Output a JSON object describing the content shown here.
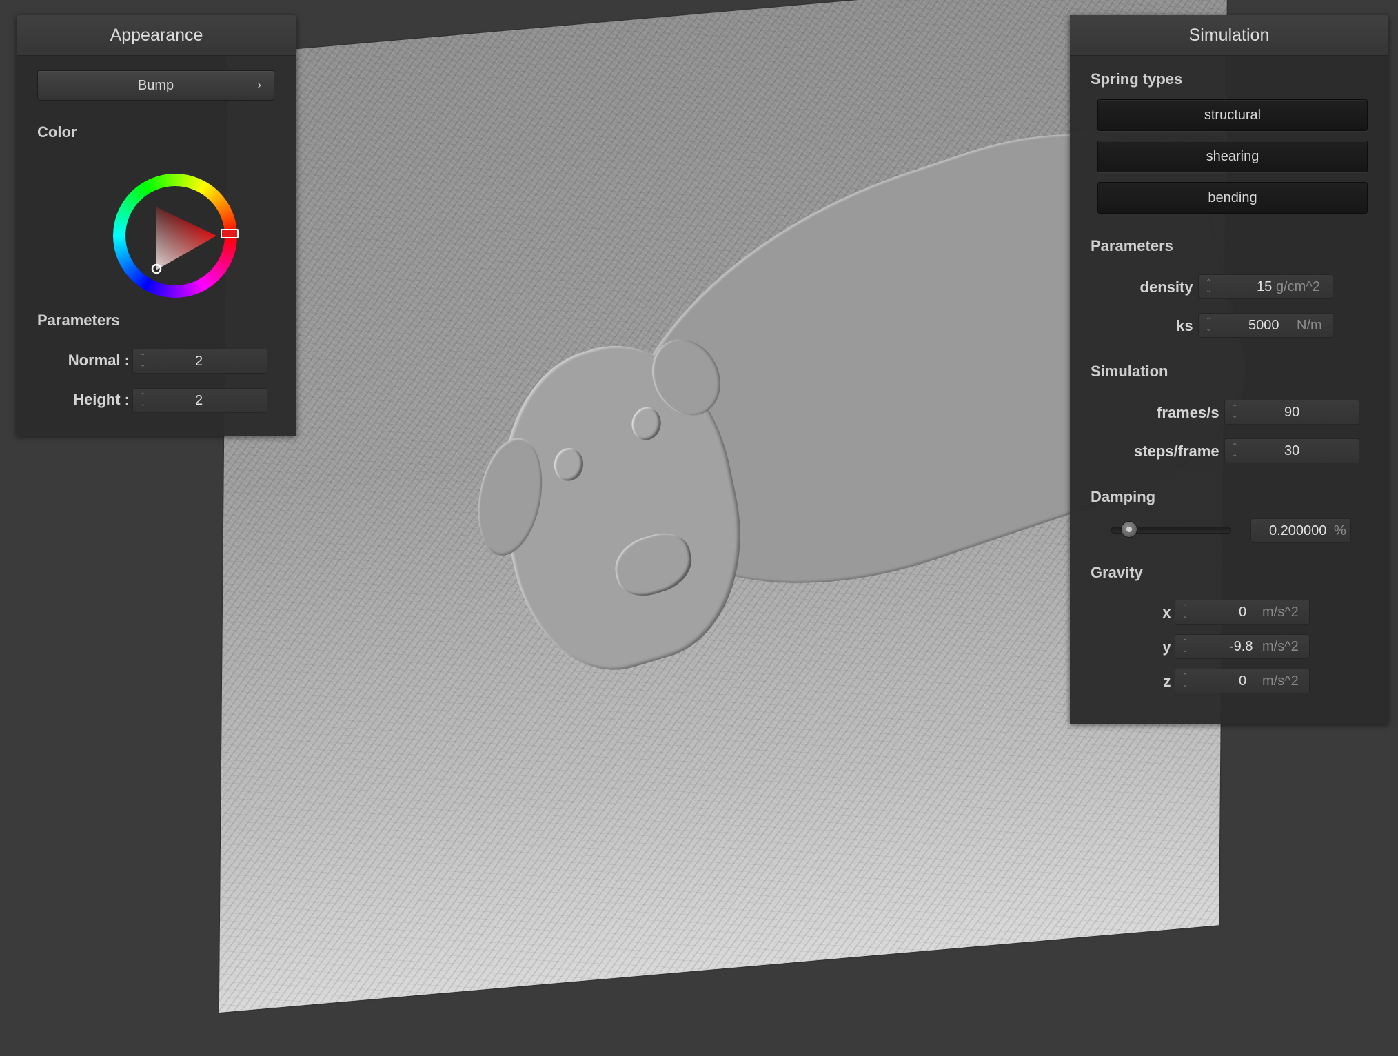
{
  "appearance": {
    "title": "Appearance",
    "mode_button": "Bump",
    "mode_chevron": "›",
    "color_label": "Color",
    "color_value": "#e21a1a",
    "parameters_label": "Parameters",
    "normal_label": "Normal :",
    "normal_value": "2",
    "height_label": "Height :",
    "height_value": "2"
  },
  "simulation": {
    "title": "Simulation",
    "spring_types_label": "Spring types",
    "spring_types": {
      "structural": "structural",
      "shearing": "shearing",
      "bending": "bending"
    },
    "parameters_label": "Parameters",
    "density_label": "density :",
    "density_value": "15",
    "density_unit": "g/cm^2",
    "ks_label": "ks :",
    "ks_value": "5000",
    "ks_unit": "N/m",
    "simulation_label": "Simulation",
    "fps_label": "frames/s :",
    "fps_value": "90",
    "steps_label": "steps/frame :",
    "steps_value": "30",
    "damping_label": "Damping",
    "damping_value": "0.200000",
    "damping_unit": "%",
    "damping_slider_fraction": 0.15,
    "gravity_label": "Gravity",
    "gx_label": "x :",
    "gx_value": "0",
    "gx_unit": "m/s^2",
    "gy_label": "y :",
    "gy_value": "-9.8",
    "gy_unit": "m/s^2",
    "gz_label": "z :",
    "gz_value": "0",
    "gz_unit": "m/s^2"
  },
  "icons": {
    "spinner": "spinner-arrows-icon",
    "chevron": "chevron-right-icon"
  }
}
